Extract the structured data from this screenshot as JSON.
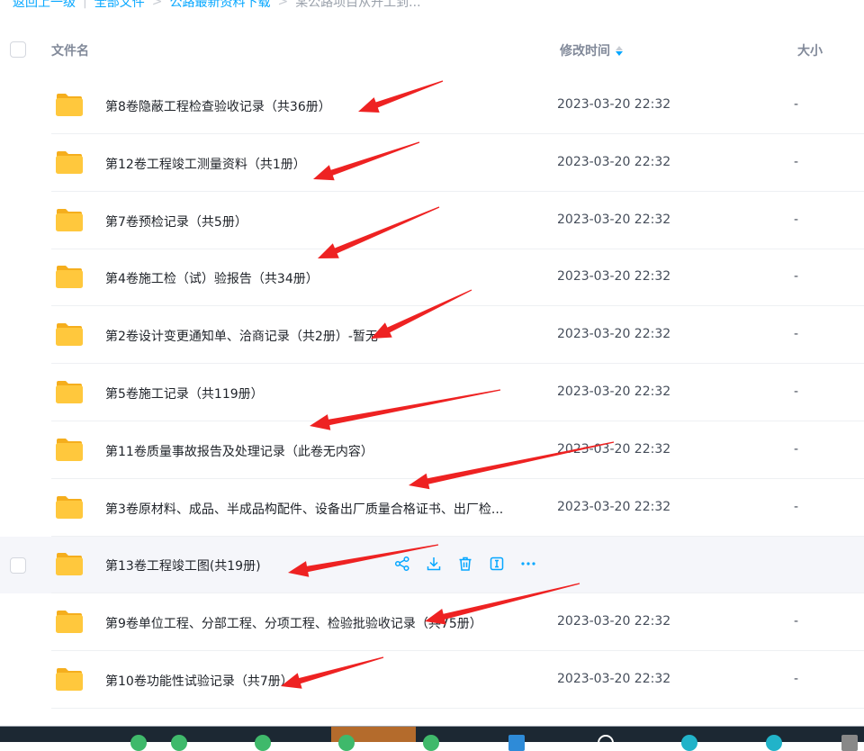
{
  "breadcrumb": {
    "back": "返回上一级",
    "all_files": "全部文件",
    "folder1": "公路最新资料下载",
    "folder2": "某公路项目从开工到..."
  },
  "columns": {
    "name": "文件名",
    "time": "修改时间",
    "size": "大小"
  },
  "rows": [
    {
      "name": "第8卷隐蔽工程检查验收记录（共36册）",
      "time": "2023-03-20 22:32",
      "size": "-"
    },
    {
      "name": "第12卷工程竣工测量资料（共1册）",
      "time": "2023-03-20 22:32",
      "size": "-"
    },
    {
      "name": "第7卷预检记录（共5册）",
      "time": "2023-03-20 22:32",
      "size": "-"
    },
    {
      "name": "第4卷施工检（试）验报告（共34册）",
      "time": "2023-03-20 22:32",
      "size": "-"
    },
    {
      "name": "第2卷设计变更通知单、洽商记录（共2册）-暂无",
      "time": "2023-03-20 22:32",
      "size": "-"
    },
    {
      "name": "第5卷施工记录（共119册）",
      "time": "2023-03-20 22:32",
      "size": "-"
    },
    {
      "name": "第11卷质量事故报告及处理记录（此卷无内容）",
      "time": "2023-03-20 22:32",
      "size": "-"
    },
    {
      "name": "第3卷原材料、成品、半成品构配件、设备出厂质量合格证书、出厂检...",
      "time": "2023-03-20 22:32",
      "size": "-"
    },
    {
      "name": "第13卷工程竣工图(共19册)",
      "time": "",
      "size": ""
    },
    {
      "name": "第9卷单位工程、分部工程、分项工程、检验批验收记录（共75册）",
      "time": "2023-03-20 22:32",
      "size": "-"
    },
    {
      "name": "第10卷功能性试验记录（共7册）",
      "time": "2023-03-20 22:32",
      "size": "-"
    }
  ],
  "hover_actions": [
    "share-icon",
    "download-icon",
    "delete-icon",
    "rename-icon",
    "more-icon"
  ],
  "colors": {
    "accent": "#06a7ff",
    "folder": "#ffc83d",
    "arrow": "#ee2222"
  }
}
